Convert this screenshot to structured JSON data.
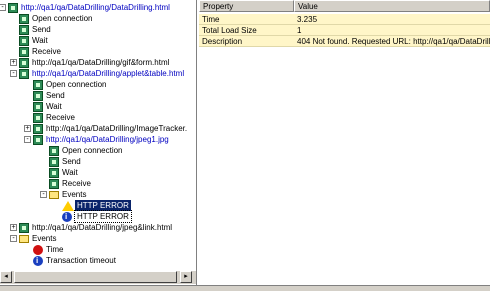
{
  "tree": [
    {
      "label": "http://qa1/qa/DataDrilling/DataDrilling.html",
      "icon": "network-node-icon",
      "link": true,
      "expander": "-",
      "level": 0
    },
    {
      "label": "Open connection",
      "icon": "network-node-icon",
      "level": 1
    },
    {
      "label": "Send",
      "icon": "network-node-icon",
      "level": 1
    },
    {
      "label": "Wait",
      "icon": "network-node-icon",
      "level": 1
    },
    {
      "label": "Receive",
      "icon": "network-node-icon",
      "level": 1
    },
    {
      "label": "http://qa1/qa/DataDrilling/gif&form.html",
      "icon": "network-node-icon",
      "expander": "+",
      "level": 1
    },
    {
      "label": "http://qa1/qa/DataDrilling/applet&table.html",
      "icon": "network-node-icon",
      "link": true,
      "expander": "-",
      "level": 1
    },
    {
      "label": "Open connection",
      "icon": "network-node-icon",
      "level": 2
    },
    {
      "label": "Send",
      "icon": "network-node-icon",
      "level": 2
    },
    {
      "label": "Wait",
      "icon": "network-node-icon",
      "level": 2
    },
    {
      "label": "Receive",
      "icon": "network-node-icon",
      "level": 2
    },
    {
      "label": "http://qa1/qa/DataDrilling/ImageTracker.",
      "icon": "network-node-icon",
      "expander": "+",
      "level": 2
    },
    {
      "label": "http://qa1/qa/DataDrilling/jpeg1.jpg",
      "icon": "network-node-icon",
      "link": true,
      "expander": "-",
      "level": 2
    },
    {
      "label": "Open connection",
      "icon": "network-node-icon",
      "level": 3
    },
    {
      "label": "Send",
      "icon": "network-node-icon",
      "level": 3
    },
    {
      "label": "Wait",
      "icon": "network-node-icon",
      "level": 3
    },
    {
      "label": "Receive",
      "icon": "network-node-icon",
      "level": 3
    },
    {
      "label": "Events",
      "icon": "folder-icon",
      "expander": "-",
      "level": 3
    },
    {
      "label": "HTTP ERROR",
      "icon": "warning-icon",
      "selected": true,
      "level": 4
    },
    {
      "label": "HTTP ERROR",
      "icon": "info-icon",
      "focus": true,
      "level": 4
    },
    {
      "label": "http://qa1/qa/DataDrilling/jpeg&link.html",
      "icon": "network-node-icon",
      "expander": "+",
      "level": 1
    },
    {
      "label": "Events",
      "icon": "folder-icon",
      "expander": "-",
      "level": 1
    },
    {
      "label": "Time",
      "icon": "error-icon",
      "level": 2
    },
    {
      "label": "Transaction timeout",
      "icon": "info-icon",
      "level": 2
    }
  ],
  "properties": {
    "header": {
      "property": "Property",
      "value": "Value"
    },
    "rows": [
      {
        "property": "Time",
        "value": "3.235"
      },
      {
        "property": "Total Load Size",
        "value": "1"
      },
      {
        "property": "Description",
        "value": "404 Not found. Requested URL: http://qa1/qa/DataDrillin"
      }
    ]
  },
  "scrollbar": {
    "left_arrow": "◂",
    "right_arrow": "▸"
  }
}
